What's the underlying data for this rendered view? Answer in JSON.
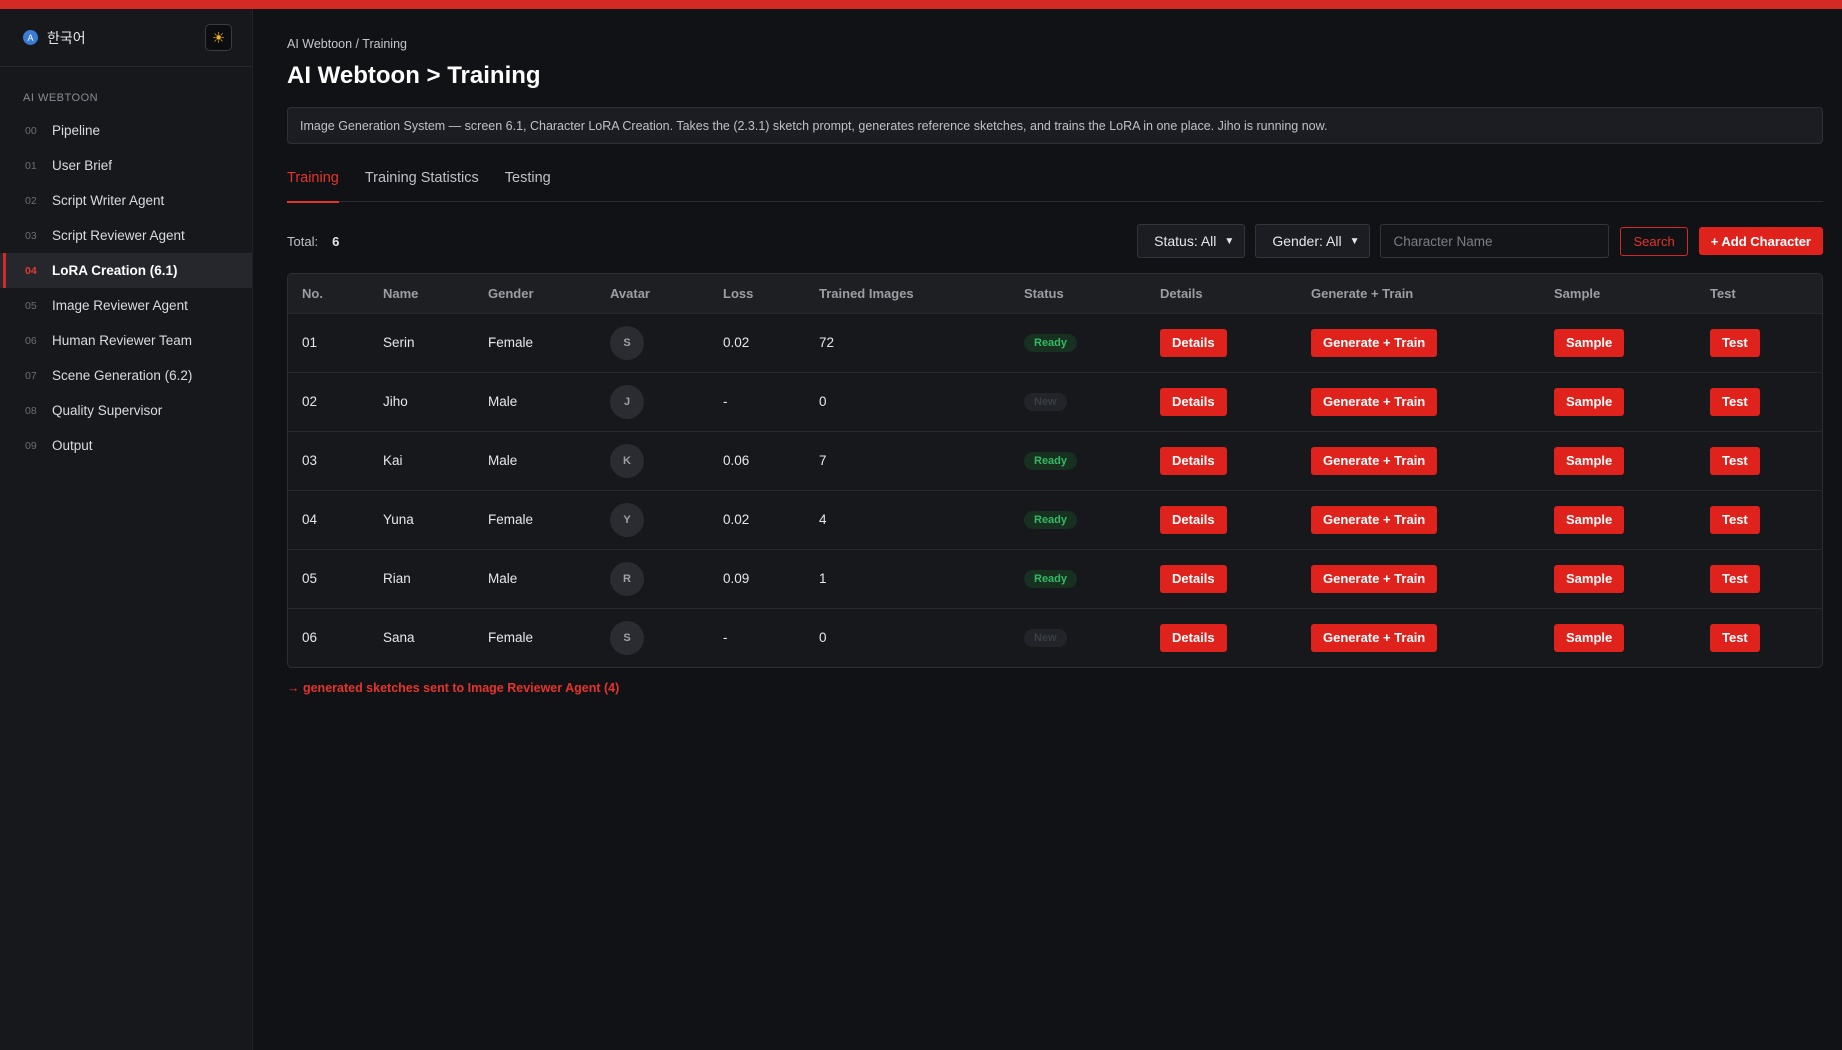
{
  "sidebar": {
    "lang_icon": "globe-icon",
    "lang_label": "한국어",
    "theme_icon": "sun-icon",
    "section_label": "AI WEBTOON",
    "items": [
      {
        "num": "00",
        "label": "Pipeline"
      },
      {
        "num": "01",
        "label": "User Brief"
      },
      {
        "num": "02",
        "label": "Script Writer Agent"
      },
      {
        "num": "03",
        "label": "Script Reviewer Agent"
      },
      {
        "num": "04",
        "label": "LoRA Creation (6.1)"
      },
      {
        "num": "05",
        "label": "Image Reviewer Agent"
      },
      {
        "num": "06",
        "label": "Human Reviewer Team"
      },
      {
        "num": "07",
        "label": "Scene Generation (6.2)"
      },
      {
        "num": "08",
        "label": "Quality Supervisor"
      },
      {
        "num": "09",
        "label": "Output"
      }
    ]
  },
  "header": {
    "breadcrumb": "AI Webtoon / Training",
    "title": "AI Webtoon > Training",
    "info": "Image Generation System — screen 6.1, Character LoRA Creation. Takes the (2.3.1) sketch prompt, generates reference sketches, and trains the LoRA in one place. Jiho is running now."
  },
  "tabs": [
    "Training",
    "Training Statistics",
    "Testing"
  ],
  "toolbar": {
    "total_label": "Total:",
    "total_value": "6",
    "status_select": "Status: All",
    "gender_select": "Gender: All",
    "search_placeholder": "Character Name",
    "search_label": "Search",
    "add_label": "+ Add Character"
  },
  "table": {
    "columns": [
      "No.",
      "Name",
      "Gender",
      "Avatar",
      "Loss",
      "Trained Images",
      "Status",
      "Details",
      "Generate + Train",
      "Sample",
      "Test"
    ],
    "rows": [
      {
        "no": "01",
        "name": "Serin",
        "gender": "Female",
        "avatar": "S",
        "loss": "0.02",
        "trained": "72",
        "status": "Ready",
        "details": "Details",
        "generate": "Generate + Train",
        "sample": "Sample",
        "test": "Test"
      },
      {
        "no": "02",
        "name": "Jiho",
        "gender": "Male",
        "avatar": "J",
        "loss": "-",
        "trained": "0",
        "status": "New",
        "details": "Details",
        "generate": "Generate + Train",
        "sample": "Sample",
        "test": "Test"
      },
      {
        "no": "03",
        "name": "Kai",
        "gender": "Male",
        "avatar": "K",
        "loss": "0.06",
        "trained": "7",
        "status": "Ready",
        "details": "Details",
        "generate": "Generate + Train",
        "sample": "Sample",
        "test": "Test"
      },
      {
        "no": "04",
        "name": "Yuna",
        "gender": "Female",
        "avatar": "Y",
        "loss": "0.02",
        "trained": "4",
        "status": "Ready",
        "details": "Details",
        "generate": "Generate + Train",
        "sample": "Sample",
        "test": "Test"
      },
      {
        "no": "05",
        "name": "Rian",
        "gender": "Male",
        "avatar": "R",
        "loss": "0.09",
        "trained": "1",
        "status": "Ready",
        "details": "Details",
        "generate": "Generate + Train",
        "sample": "Sample",
        "test": "Test"
      },
      {
        "no": "06",
        "name": "Sana",
        "gender": "Female",
        "avatar": "S",
        "loss": "-",
        "trained": "0",
        "status": "New",
        "details": "Details",
        "generate": "Generate + Train",
        "sample": "Sample",
        "test": "Test"
      }
    ]
  },
  "footer_note": "→ generated sketches sent to Image Reviewer Agent (4)",
  "colors": {
    "accent": "#e0221c",
    "ready": "#35b865",
    "background": "#111216"
  }
}
